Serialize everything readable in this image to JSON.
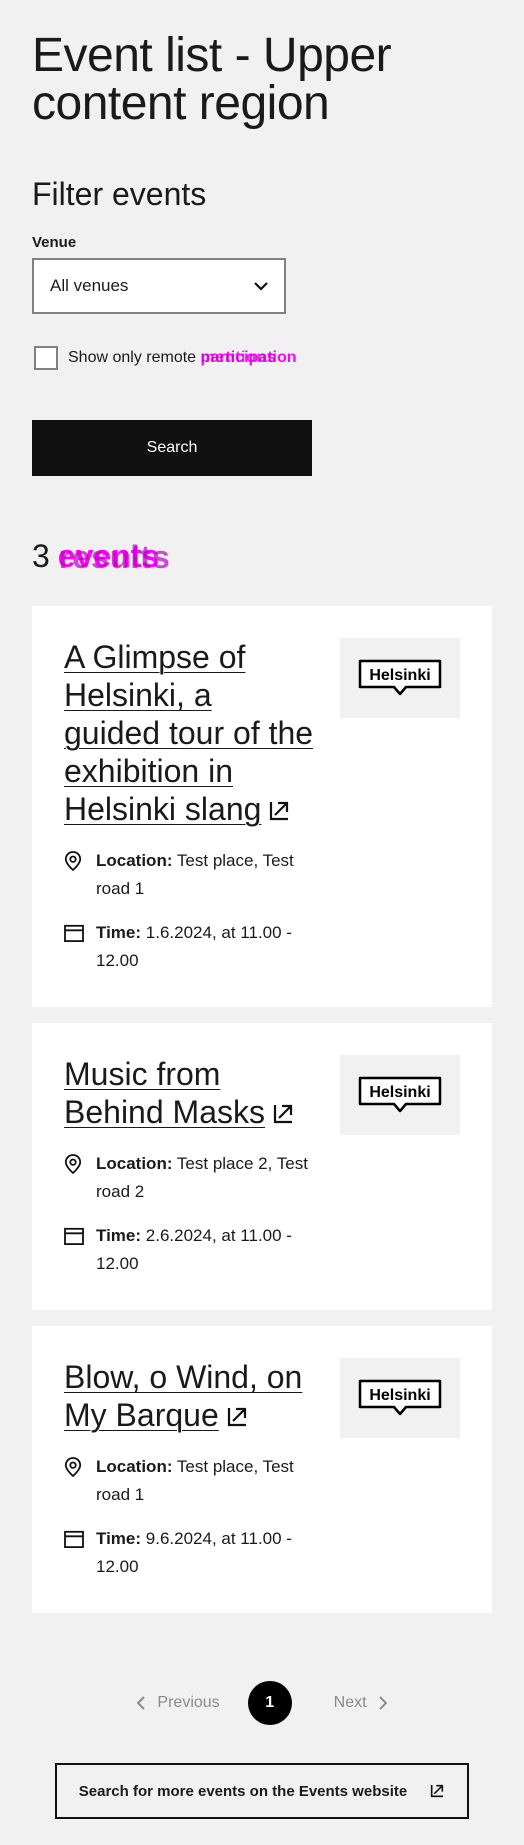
{
  "page": {
    "title": "Event list - Upper content region"
  },
  "filter": {
    "title": "Filter events",
    "venue_label": "Venue",
    "venue_selected": "All venues",
    "remote_checkbox_label": "Show only remote",
    "remote_checkbox_word": "participation",
    "remote_checkbox_ghost": "mentions",
    "search_button": "Search"
  },
  "results": {
    "count": "3",
    "count_word": "events",
    "count_ghost": "results"
  },
  "events": [
    {
      "title": "A Glimpse of Helsinki, a guided tour of the exhibition in Helsinki slang",
      "location_label": "Location:",
      "location": "Test place, Test road 1",
      "time_label": "Time:",
      "time": "1.6.2024, at 11.00 - 12.00",
      "logo_text": "Helsinki"
    },
    {
      "title": "Music from Behind Masks",
      "location_label": "Location:",
      "location": "Test place 2, Test road 2",
      "time_label": "Time:",
      "time": "2.6.2024, at 11.00 - 12.00",
      "logo_text": "Helsinki"
    },
    {
      "title": "Blow, o Wind, on My Barque",
      "location_label": "Location:",
      "location": "Test place, Test road 1",
      "time_label": "Time:",
      "time": "9.6.2024, at 11.00 - 12.00",
      "logo_text": "Helsinki"
    }
  ],
  "pagination": {
    "previous": "Previous",
    "current": "1",
    "next": "Next"
  },
  "more_button": "Search for more events on the Events website",
  "icons": {
    "chevron": "chevron-down-icon",
    "location": "location-pin-icon",
    "time": "calendar-icon",
    "external": "external-link-icon"
  },
  "colors": {
    "background": "#f1f1f1",
    "primary": "#111111",
    "highlight": "#ff00ff"
  }
}
